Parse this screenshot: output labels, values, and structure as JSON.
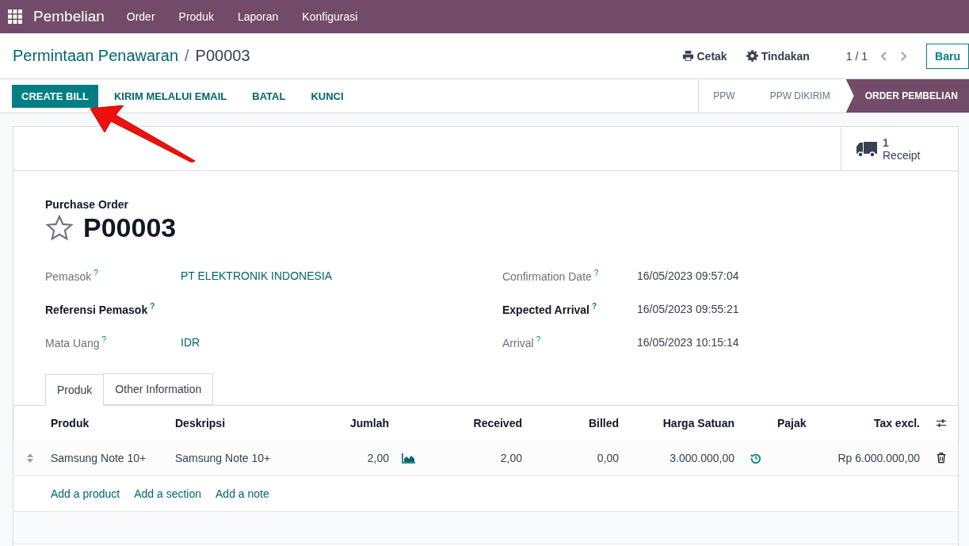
{
  "navbar": {
    "app": "Pembelian",
    "menu": [
      "Order",
      "Produk",
      "Laporan",
      "Konfigurasi"
    ]
  },
  "breadcrumb": {
    "parent": "Permintaan Penawaran",
    "separator": "/",
    "current": "P00003"
  },
  "control_panel": {
    "print": "Cetak",
    "action": "Tindakan",
    "pager": "1 / 1",
    "new_button": "Baru"
  },
  "actions": [
    {
      "label": "CREATE BILL",
      "primary": true
    },
    {
      "label": "KIRIM MELALUI EMAIL",
      "primary": false
    },
    {
      "label": "BATAL",
      "primary": false
    },
    {
      "label": "KUNCI",
      "primary": false
    }
  ],
  "statusbar": [
    {
      "label": "PPW",
      "selected": false
    },
    {
      "label": "PPW DIKIRIM",
      "selected": false
    },
    {
      "label": "ORDER PEMBELIAN",
      "selected": true
    }
  ],
  "smart_button": {
    "count": "1",
    "label": "Receipt"
  },
  "form": {
    "subtitle": "Purchase Order",
    "title": "P00003",
    "favorite": false,
    "left_fields": [
      {
        "label": "Pemasok",
        "help": "?",
        "value": "PT ELEKTRONIK INDONESIA",
        "required": false
      },
      {
        "label": "Referensi Pemasok",
        "help": "?",
        "required": true
      },
      {
        "label": "Mata Uang",
        "help": "?",
        "value": "IDR",
        "required": false
      }
    ],
    "right_fields": [
      {
        "label": "Confirmation Date",
        "help": "?",
        "value": "16/05/2023 09:57:04",
        "required": false
      },
      {
        "label": "Expected Arrival",
        "help": "?",
        "value": "16/05/2023 09:55:21",
        "required": true
      },
      {
        "label": "Arrival",
        "help": "?",
        "value": "16/05/2023 10:15:14",
        "required": false
      }
    ]
  },
  "tabs": [
    {
      "label": "Produk",
      "selected": true
    },
    {
      "label": "Other Information",
      "selected": false
    }
  ],
  "table": {
    "columns": [
      "Produk",
      "Deskripsi",
      "Jumlah",
      "Received",
      "Billed",
      "Harga Satuan",
      "Pajak",
      "Tax excl."
    ],
    "rows": [
      {
        "product": "Samsung Note 10+",
        "description": "Samsung Note 10+",
        "quantity": "2,00",
        "received": "2,00",
        "billed": "0,00",
        "unit_price": "3.000.000,00",
        "subtotal": "Rp 6.000.000,00"
      }
    ],
    "add_links": [
      "Add a product",
      "Add a section",
      "Add a note"
    ]
  },
  "annotation": {
    "kind": "arrow"
  }
}
